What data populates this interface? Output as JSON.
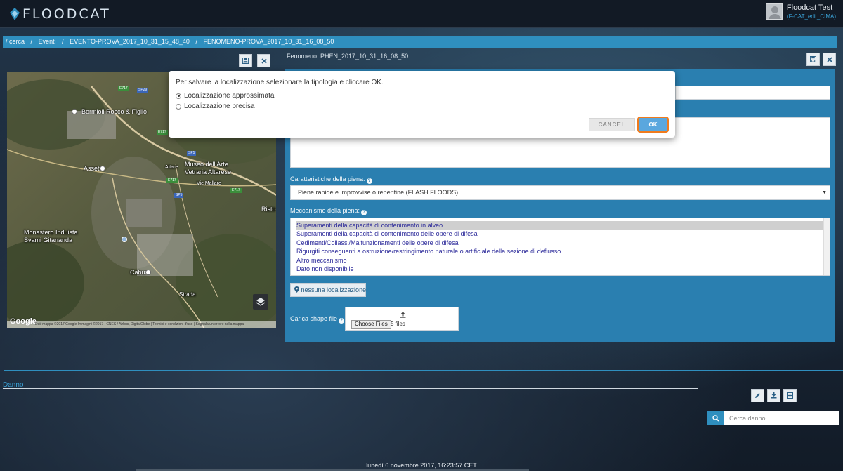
{
  "app": {
    "logo_text": "FLOODCAT",
    "user": {
      "name": "Floodcat Test",
      "role": "(F-CAT_edit_CIMA)"
    }
  },
  "breadcrumb": {
    "items": [
      "/ cerca",
      "Eventi",
      "EVENTO-PROVA_2017_10_31_15_48_40",
      "FENOMENO-PROVA_2017_10_31_16_08_50"
    ],
    "separator": "/"
  },
  "fenomeno": {
    "label": "Fenomeno: PHEN_2017_10_31_16_08_50"
  },
  "map": {
    "places": [
      "Bormioli Rocco & Figlio",
      "Asset",
      "Museo dell'Arte Vetraria Altarese",
      "Risto",
      "Monastero Induista Svami Gitananda",
      "Cabur",
      "Strada",
      "Vie Mallare",
      "Altare"
    ],
    "roads": [
      "SP29",
      "E717",
      "E717",
      "E717",
      "SP5",
      "E717",
      "SP5"
    ],
    "google": "Google",
    "footer": "Dati mappa ©2017 Google Immagini ©2017 , CNES / Airbus, DigitalGlobe  |  Termini e condizioni d'uso  |  Segnala un errore nella mappa"
  },
  "form": {
    "piena_label": "Caratteristiche della piena:",
    "piena_value": "Piene rapide e improvvise o repentine (FLASH FLOODS)",
    "meccanismo_label": "Meccanismo della piena:",
    "meccanismo_options": [
      "Superamenti della capacità di contenimento in alveo",
      "Superamenti della capacità di contenimento delle opere di difesa",
      "Cedimenti/Collassi/Malfunzionamenti delle opere di difesa",
      "Rigurgiti conseguenti a ostruzione/restringimento naturale o artificiale della sezione di deflusso",
      "Altro meccanismo",
      "Dato non disponibile"
    ],
    "localizzazione_button": "nessuna localizzazione",
    "shape_label": "Carica shape file",
    "choose_files": "Choose Files",
    "files_status": "5 files"
  },
  "modal": {
    "message": "Per salvare la localizzazione selezionare la tipologia e cliccare OK.",
    "options": [
      "Localizzazione approssimata",
      "Localizzazione precisa"
    ],
    "selected": 0,
    "cancel": "CANCEL",
    "ok": "OK"
  },
  "danno": {
    "title": "Danno",
    "search_placeholder": "Cerca danno"
  },
  "footer": {
    "datetime": "lunedì 6 novembre 2017, 16:23:57 CET"
  },
  "colors": {
    "accent": "#2f8fbf",
    "panel": "#2a7fb0",
    "ok_border": "#f07b1d",
    "ok_bg": "#5aa7de"
  }
}
